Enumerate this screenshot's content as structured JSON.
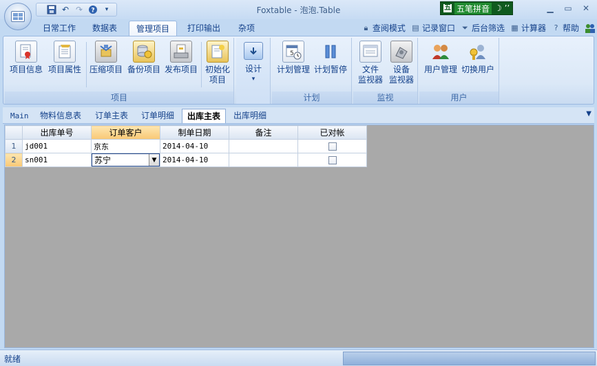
{
  "window": {
    "title": "Foxtable - 泡泡.Table",
    "ime_label": "五笔拼音",
    "ime_extra": "☽ ’’"
  },
  "qat": [
    "save-icon",
    "undo-icon",
    "redo-icon",
    "help-icon"
  ],
  "ribbon_tabs": [
    "日常工作",
    "数据表",
    "管理项目",
    "打印输出",
    "杂项"
  ],
  "active_ribbon_tab": "管理项目",
  "right_tools": {
    "readonly_mode": "查阅模式",
    "record_window": "记录窗口",
    "background_filter": "后台筛选",
    "calculator": "计算器",
    "help": "帮助"
  },
  "ribbon": {
    "project_group": {
      "label": "项目",
      "buttons": {
        "project_info": "项目信息",
        "project_props": "项目属性",
        "compress": "压缩项目",
        "backup": "备份项目",
        "publish": "发布项目",
        "init_line1": "初始化",
        "init_line2": "项目"
      }
    },
    "design_group": {
      "button": "设计",
      "arrow": "▾"
    },
    "plan_group": {
      "label": "计划",
      "buttons": {
        "plan_manage": "计划管理",
        "plan_pause": "计划暂停"
      }
    },
    "monitor_group": {
      "label": "监视",
      "buttons": {
        "file_line1": "文件",
        "file_line2": "监视器",
        "device_line1": "设备",
        "device_line2": "监视器"
      }
    },
    "user_group": {
      "label": "用户",
      "buttons": {
        "user_manage": "用户管理",
        "switch_user": "切换用户"
      }
    }
  },
  "doc_tabs": [
    "Main",
    "物料信息表",
    "订单主表",
    "订单明细",
    "出库主表",
    "出库明细"
  ],
  "active_doc_tab": "出库主表",
  "grid": {
    "columns": [
      "出库单号",
      "订单客户",
      "制单日期",
      "备注",
      "已对帐"
    ],
    "selected_column": "订单客户",
    "rows": [
      {
        "num": "1",
        "id": "jd001",
        "customer": "京东",
        "date": "2014-04-10",
        "note": "",
        "checked": false
      },
      {
        "num": "2",
        "id": "sn001",
        "customer": "苏宁",
        "date": "2014-04-10",
        "note": "",
        "checked": false
      }
    ],
    "editing_row": "2"
  },
  "status": {
    "text": "就绪"
  }
}
